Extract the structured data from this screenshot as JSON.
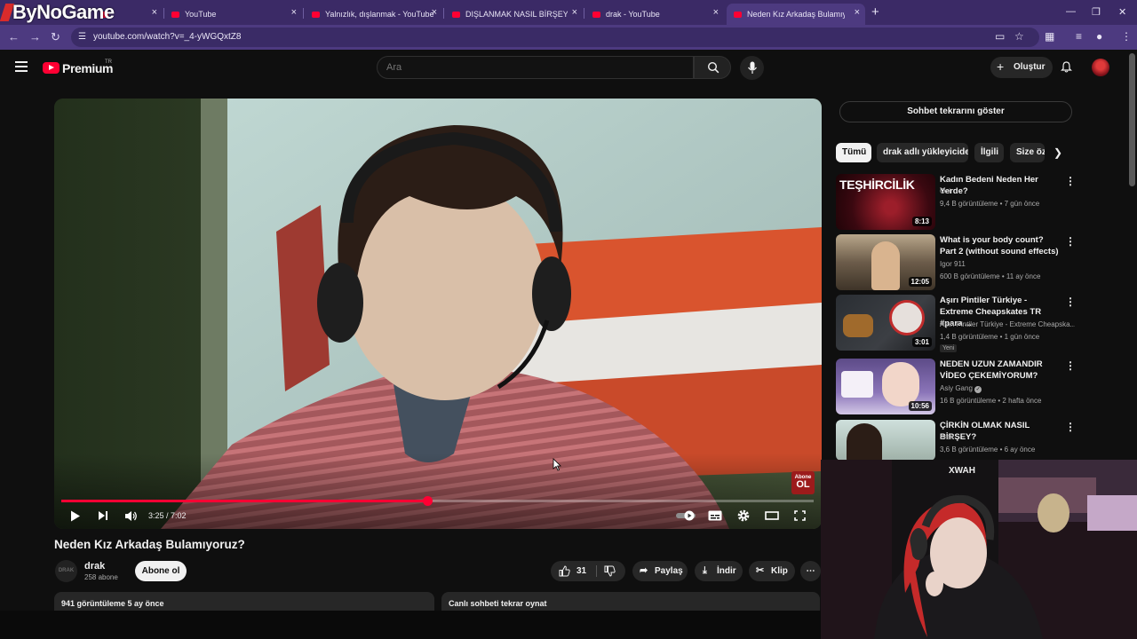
{
  "overlay": {
    "logo_text": "ByNoGame"
  },
  "browser": {
    "tabs": [
      {
        "title": ""
      },
      {
        "title": "YouTube"
      },
      {
        "title": "Yalnızlık, dışlanmak - YouTube"
      },
      {
        "title": "DIŞLANMAK NASIL BİRŞEY? - Y"
      },
      {
        "title": "drak - YouTube"
      },
      {
        "title": "Neden Kız Arkadaş Bulamıy"
      }
    ],
    "url": "youtube.com/watch?v=_4-yWGQxtZ8",
    "close_glyph": "×",
    "new_tab_glyph": "+"
  },
  "masthead": {
    "logo_word": "Premium",
    "country": "TR",
    "search_placeholder": "Ara",
    "create_label": "Oluştur"
  },
  "player": {
    "time_text": "3:25 / 7:02",
    "progress_percent": 48.7,
    "watermark_line1": "Abone",
    "watermark_line2": "OL"
  },
  "video": {
    "title": "Neden Kız Arkadaş Bulamıyoruz?",
    "channel": "drak",
    "channel_avatar_text": "DRAK",
    "subscribers": "258 abone",
    "subscribe_label": "Abone ol",
    "likes": "31",
    "share_label": "Paylaş",
    "download_label": "İndir",
    "clip_label": "Klip",
    "views_line": "941 görüntüleme  5 ay önce",
    "chat_replay": "Canlı sohbeti tekrar oynat"
  },
  "sidebar": {
    "chat_button": "Sohbet tekrarını göster",
    "chips": [
      "Tümü",
      "drak adlı yükleyiciden",
      "İlgili",
      "Size öz"
    ],
    "recommendations": [
      {
        "title": "Kadın Bedeni Neden Her Yerde?",
        "channel": "Ozi",
        "meta": "9,4 B görüntüleme • 7 gün önce",
        "duration": "8:13",
        "thumb_text": "TEŞHİRCİLİK",
        "verified": false,
        "new_badge": ""
      },
      {
        "title": "What is your body count? Part 2 (without sound effects)",
        "channel": "Igor 911",
        "meta": "600 B görüntüleme • 11 ay önce",
        "duration": "12:05",
        "thumb_text": "",
        "verified": false,
        "new_badge": ""
      },
      {
        "title": "Aşırı Pintiler Türkiye - Extreme Cheapskates TR #para ...",
        "channel": "Aşırı Pintiler Türkiye - Extreme Cheapska...",
        "meta": "1,4 B görüntüleme • 1 gün önce",
        "duration": "3:01",
        "thumb_text": "",
        "verified": false,
        "new_badge": "Yeni"
      },
      {
        "title": "NEDEN UZUN ZAMANDIR VİDEO ÇEKEMİYORUM?",
        "channel": "Asiy Gang",
        "meta": "16 B görüntüleme • 2 hafta önce",
        "duration": "10:56",
        "thumb_text": "",
        "verified": true,
        "new_badge": ""
      },
      {
        "title": "ÇİRKİN OLMAK NASIL BİRŞEY?",
        "channel": "drak",
        "meta": "3,6 B görüntüleme • 6 ay önce",
        "duration": "",
        "thumb_text": "",
        "verified": false,
        "new_badge": ""
      }
    ]
  },
  "webcam": {
    "hoodie_text": "XWAH"
  },
  "colors": {
    "accent": "#ff0033",
    "browser_tabbar": "#3b2a66",
    "browser_toolbar": "#4d3a80",
    "page_bg": "#0f0f0f"
  },
  "icons": [
    "hamburger-icon",
    "youtube-logo-icon",
    "search-icon",
    "mic-icon",
    "plus-icon",
    "bell-icon",
    "play-icon",
    "next-icon",
    "volume-icon",
    "autoplay-toggle",
    "subtitles-icon",
    "settings-icon",
    "theater-icon",
    "fullscreen-icon",
    "like-icon",
    "dislike-icon",
    "share-icon",
    "download-icon",
    "scissors-icon",
    "more-icon",
    "chevron-right-icon"
  ]
}
